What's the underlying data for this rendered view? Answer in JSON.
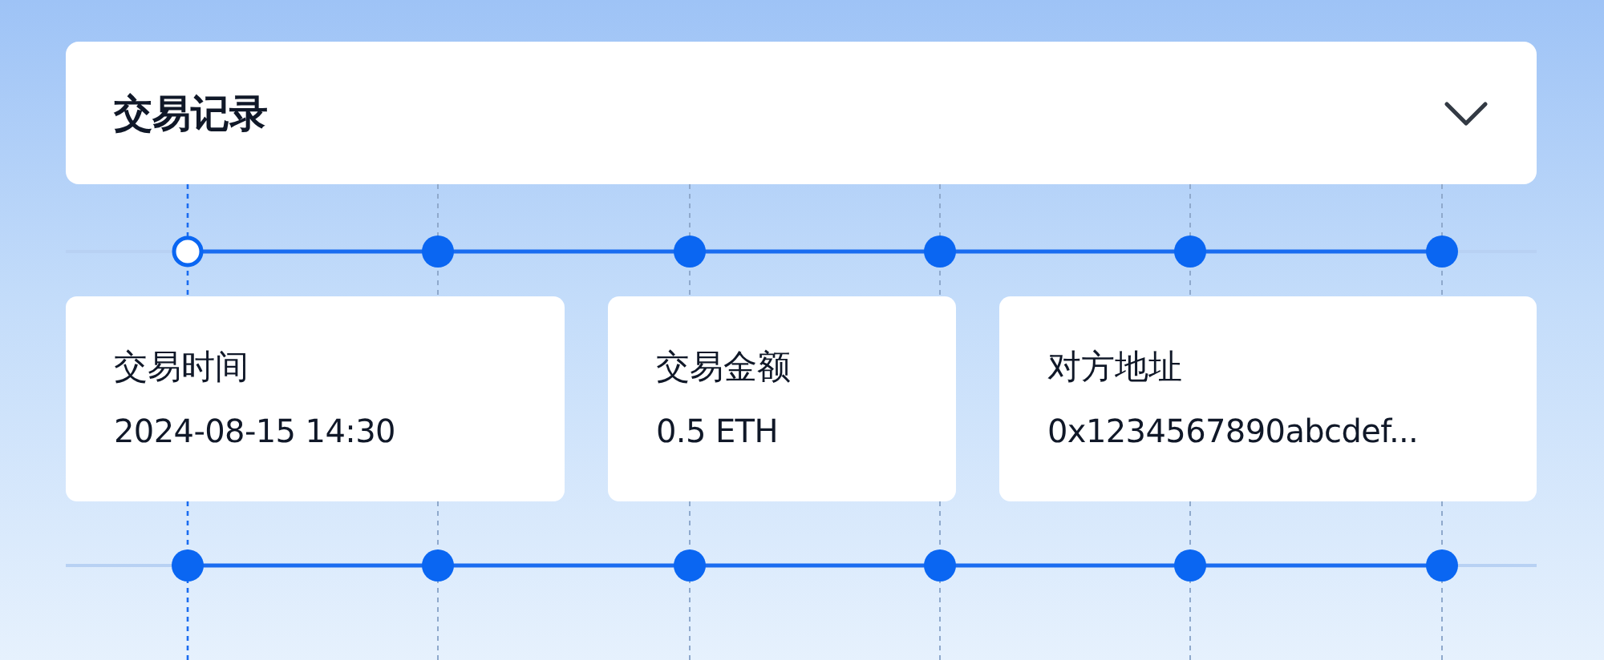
{
  "header": {
    "title": "交易记录",
    "expanded": false
  },
  "timelines": [
    {
      "nodes": [
        {
          "selected": true
        },
        {
          "selected": false
        },
        {
          "selected": false
        },
        {
          "selected": false
        },
        {
          "selected": false
        },
        {
          "selected": false
        }
      ]
    },
    {
      "nodes": [
        {
          "selected": false
        },
        {
          "selected": false
        },
        {
          "selected": false
        },
        {
          "selected": false
        },
        {
          "selected": false
        },
        {
          "selected": false
        }
      ]
    }
  ],
  "cards": [
    {
      "label": "交易时间",
      "value": "2024-08-15 14:30"
    },
    {
      "label": "交易金额",
      "value": "0.5 ETH"
    },
    {
      "label": "对方地址",
      "value": "0x1234567890abcdef..."
    }
  ]
}
